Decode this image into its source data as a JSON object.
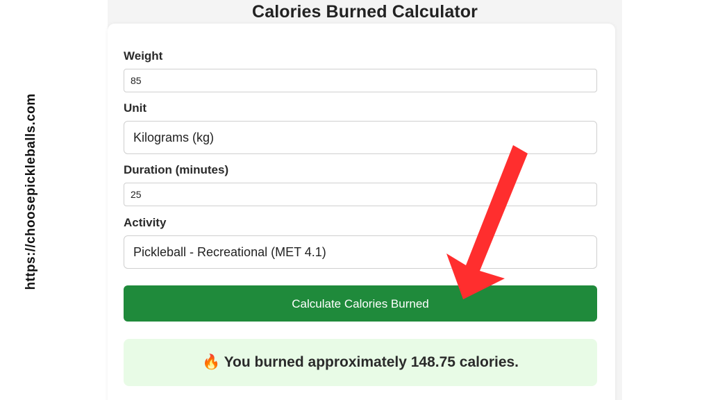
{
  "page_title": "Calories Burned Calculator",
  "side_url": "https://choosepickleballs.com",
  "form": {
    "weight": {
      "label": "Weight",
      "value": "85"
    },
    "unit": {
      "label": "Unit",
      "selected": "Kilograms (kg)"
    },
    "duration": {
      "label": "Duration (minutes)",
      "value": "25"
    },
    "activity": {
      "label": "Activity",
      "selected": "Pickleball - Recreational (MET 4.1)"
    }
  },
  "calculate_button": {
    "label": "Calculate Calories Burned"
  },
  "result": {
    "icon": "fire-icon",
    "emoji": "🔥",
    "text": "You burned approximately 148.75 calories."
  },
  "colors": {
    "button": "#1f8a3b",
    "result_bg": "#e8fbe6",
    "arrow": "#ff2e2e"
  }
}
